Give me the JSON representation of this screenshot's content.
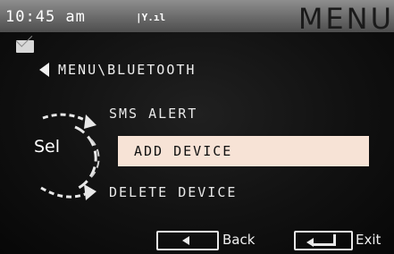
{
  "status": {
    "time": "10:45 am",
    "signal": "|Y.ıl"
  },
  "header": {
    "title": "MENU"
  },
  "icons": {
    "mail": "mail-icon",
    "back": "back-arrow-icon",
    "enter": "enter-icon"
  },
  "breadcrumb": "MENU\\BLUETOOTH",
  "selector": {
    "label": "Sel"
  },
  "menu": {
    "items": [
      {
        "label": "SMS ALERT",
        "selected": false
      },
      {
        "label": "ADD DEVICE",
        "selected": true
      },
      {
        "label": "DELETE DEVICE",
        "selected": false
      }
    ]
  },
  "softkeys": {
    "back": "Back",
    "exit": "Exit"
  },
  "colors": {
    "highlight": "#f7e3d6",
    "topbar": "#7a7a7a"
  }
}
